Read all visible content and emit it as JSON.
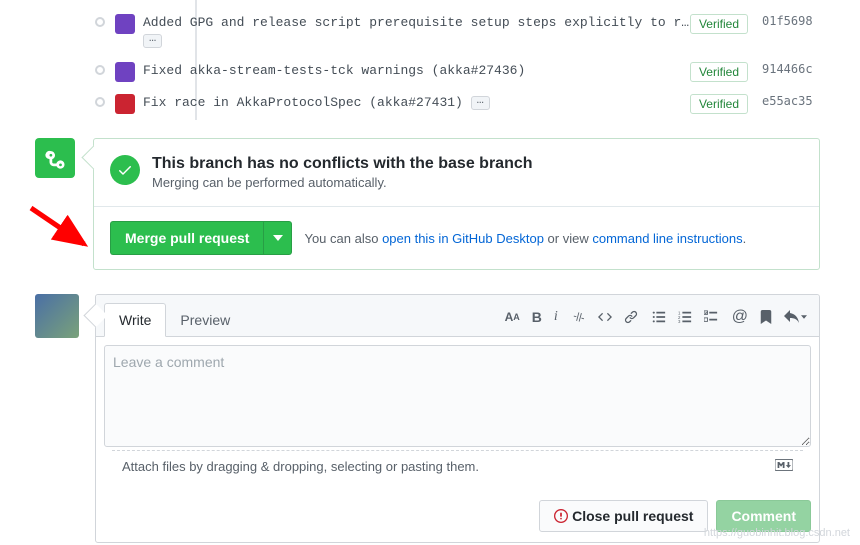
{
  "commits": [
    {
      "avatar": "purple",
      "message": "Added GPG and release script prerequisite setup steps explicitly to r…",
      "has_ellipsis": true,
      "verified": "Verified",
      "sha": "01f5698"
    },
    {
      "avatar": "purple",
      "message": "Fixed akka-stream-tests-tck warnings (akka#27436)",
      "has_ellipsis": false,
      "verified": "Verified",
      "sha": "914466c"
    },
    {
      "avatar": "red",
      "message": "Fix race in AkkaProtocolSpec (akka#27431)",
      "has_ellipsis": true,
      "verified": "Verified",
      "sha": "e55ac35"
    }
  ],
  "merge": {
    "title": "This branch has no conflicts with the base branch",
    "subtitle": "Merging can be performed automatically.",
    "merge_button_label": "Merge pull request",
    "help_prefix": "You can also ",
    "help_link_desktop": "open this in GitHub Desktop",
    "help_mid": " or view ",
    "help_link_cli": "command line instructions",
    "help_suffix": "."
  },
  "comment": {
    "tab_write": "Write",
    "tab_preview": "Preview",
    "placeholder": "Leave a comment",
    "attach_hint": "Attach files by dragging & dropping, selecting or pasting them.",
    "close_label": "Close pull request",
    "comment_label": "Comment"
  },
  "watermark": "https://guobinhit.blog.csdn.net"
}
